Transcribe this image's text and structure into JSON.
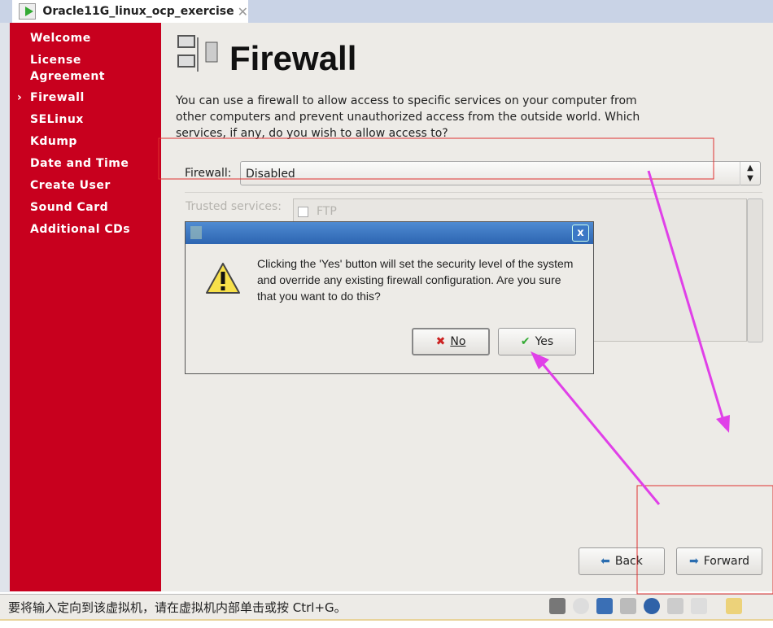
{
  "tab": {
    "title": "Oracle11G_linux_ocp_exercise",
    "close": "✕"
  },
  "sidebar": {
    "items": [
      {
        "label": "Welcome"
      },
      {
        "label": "License\nAgreement"
      },
      {
        "label": "Firewall",
        "current": true
      },
      {
        "label": "SELinux"
      },
      {
        "label": "Kdump"
      },
      {
        "label": "Date and Time"
      },
      {
        "label": "Create User"
      },
      {
        "label": "Sound Card"
      },
      {
        "label": "Additional CDs"
      }
    ],
    "current_marker": "›"
  },
  "page": {
    "title": "Firewall",
    "description": "You can use a firewall to allow access to specific services on your computer from other computers and prevent unauthorized access from the outside world.  Which services, if any, do you wish to allow access to?",
    "firewall_label": "Firewall:",
    "firewall_value": "Disabled",
    "trusted_label": "Trusted services:",
    "services": [
      {
        "label": "FTP",
        "checked": false
      }
    ]
  },
  "dialog": {
    "message": "Clicking the 'Yes' button will set the security level of the system and override any existing firewall configuration.  Are you sure that you want to do this?",
    "no": "No",
    "yes": "Yes",
    "close": "x"
  },
  "nav_buttons": {
    "back": "Back",
    "forward": "Forward"
  },
  "status": {
    "text": "要将输入定向到该虚拟机，请在虚拟机内部单击或按 Ctrl+G。"
  },
  "colors": {
    "sidebar": "#c8001e",
    "annotation_box": "#e03030",
    "annotation_arrow": "#e040e8"
  }
}
